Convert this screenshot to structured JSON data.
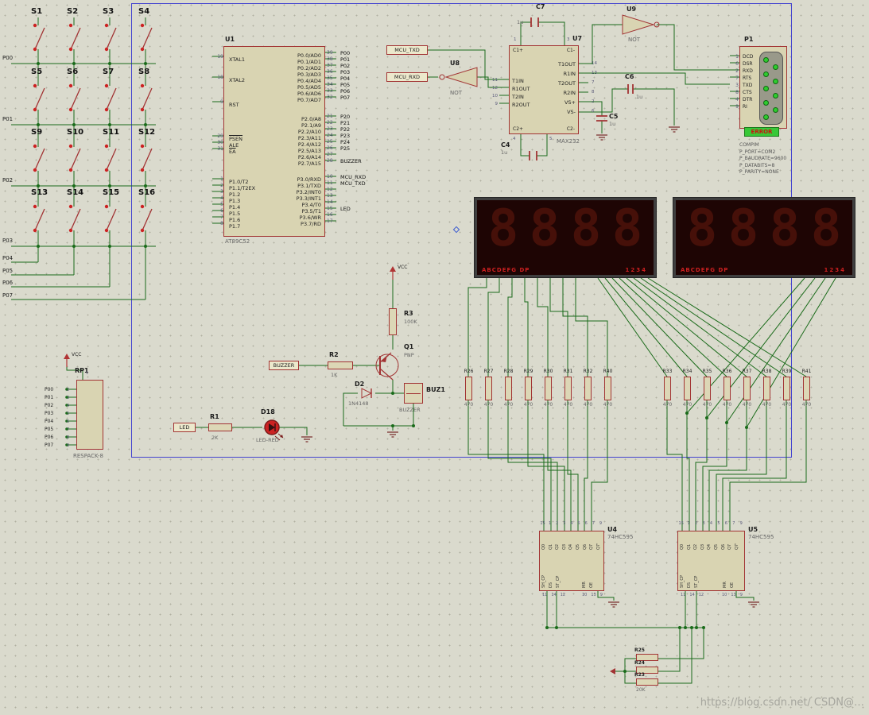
{
  "watermark": "https://blog.csdn.net/  CSDN@…",
  "power": {
    "vcc_label": "VCC"
  },
  "keypad": {
    "switches": [
      {
        "ref": "S1"
      },
      {
        "ref": "S2"
      },
      {
        "ref": "S3"
      },
      {
        "ref": "S4"
      },
      {
        "ref": "S5"
      },
      {
        "ref": "S6"
      },
      {
        "ref": "S7"
      },
      {
        "ref": "S8"
      },
      {
        "ref": "S9"
      },
      {
        "ref": "S10"
      },
      {
        "ref": "S11"
      },
      {
        "ref": "S12"
      },
      {
        "ref": "S13"
      },
      {
        "ref": "S14"
      },
      {
        "ref": "S15"
      },
      {
        "ref": "S16"
      }
    ],
    "row_nets": [
      "P00",
      "P01",
      "P02",
      "P03"
    ],
    "col_nets": [
      "P04",
      "P05",
      "P06",
      "P07"
    ]
  },
  "u1": {
    "ref": "U1",
    "part": "AT89C52",
    "left_a": [
      {
        "num": "19",
        "name": "XTAL1"
      },
      {
        "num": "18",
        "name": "XTAL2"
      },
      {
        "num": "9",
        "name": "RST"
      }
    ],
    "left_b": [
      {
        "num": "29",
        "name": "PSEN",
        "bar": true
      },
      {
        "num": "30",
        "name": "ALE"
      },
      {
        "num": "31",
        "name": "EA",
        "bar": true
      }
    ],
    "left_c": [
      {
        "num": "1",
        "name": "P1.0/T2"
      },
      {
        "num": "2",
        "name": "P1.1/T2EX"
      },
      {
        "num": "3",
        "name": "P1.2"
      },
      {
        "num": "4",
        "name": "P1.3"
      },
      {
        "num": "5",
        "name": "P1.4"
      },
      {
        "num": "6",
        "name": "P1.5"
      },
      {
        "num": "7",
        "name": "P1.6"
      },
      {
        "num": "8",
        "name": "P1.7"
      }
    ],
    "right_p0": [
      {
        "name": "P0.0/AD0",
        "num": "39",
        "net": "P00"
      },
      {
        "name": "P0.1/AD1",
        "num": "38",
        "net": "P01"
      },
      {
        "name": "P0.2/AD2",
        "num": "37",
        "net": "P02"
      },
      {
        "name": "P0.3/AD3",
        "num": "36",
        "net": "P03"
      },
      {
        "name": "P0.4/AD4",
        "num": "35",
        "net": "P04"
      },
      {
        "name": "P0.5/AD5",
        "num": "34",
        "net": "P05"
      },
      {
        "name": "P0.6/AD6",
        "num": "33",
        "net": "P06"
      },
      {
        "name": "P0.7/AD7",
        "num": "32",
        "net": "P07"
      }
    ],
    "right_p2": [
      {
        "name": "P2.0/A8",
        "num": "21",
        "net": "P20"
      },
      {
        "name": "P2.1/A9",
        "num": "22",
        "net": "P21"
      },
      {
        "name": "P2.2/A10",
        "num": "23",
        "net": "P22"
      },
      {
        "name": "P2.3/A11",
        "num": "24",
        "net": "P23"
      },
      {
        "name": "P2.4/A12",
        "num": "25",
        "net": "P24"
      },
      {
        "name": "P2.5/A13",
        "num": "26",
        "net": "P25"
      },
      {
        "name": "P2.6/A14",
        "num": "27",
        "net": ""
      },
      {
        "name": "P2.7/A15",
        "num": "28",
        "net": "BUZZER"
      }
    ],
    "right_p3": [
      {
        "name": "P3.0/RXD",
        "num": "10",
        "net": "MCU_RXD"
      },
      {
        "name": "P3.1/TXD",
        "num": "11",
        "net": "MCU_TXD"
      },
      {
        "name": "P3.2/INT0",
        "num": "12",
        "net": ""
      },
      {
        "name": "P3.3/INT1",
        "num": "13",
        "net": ""
      },
      {
        "name": "P3.4/T0",
        "num": "14",
        "net": ""
      },
      {
        "name": "P3.5/T1",
        "num": "15",
        "net": "LED"
      },
      {
        "name": "P3.6/WR",
        "num": "16",
        "net": ""
      },
      {
        "name": "P3.7/RD",
        "num": "17",
        "net": ""
      }
    ]
  },
  "serial": {
    "txd_terminal": "MCU_TXD",
    "rxd_terminal": "MCU_RXD",
    "u8": {
      "ref": "U8",
      "part": "NOT"
    },
    "u9": {
      "ref": "U9",
      "part": "NOT"
    },
    "u7": {
      "ref": "U7",
      "part": "MAX232",
      "corners": {
        "c1p": "C1+",
        "c1m": "C1-",
        "c2p": "C2+",
        "c2m": "C2-"
      },
      "left": [
        {
          "num": "11",
          "name": "T1IN"
        },
        {
          "num": "12",
          "name": "R1OUT"
        },
        {
          "num": "10",
          "name": "T2IN"
        },
        {
          "num": "9",
          "name": "R2OUT"
        }
      ],
      "right": [
        {
          "num": "14",
          "name": "T1OUT"
        },
        {
          "num": "13",
          "name": "R1IN"
        },
        {
          "num": "7",
          "name": "T2OUT"
        },
        {
          "num": "8",
          "name": "R2IN"
        },
        {
          "num": "2",
          "name": "VS+"
        },
        {
          "num": "6",
          "name": "VS-"
        }
      ],
      "top_nums": [
        "1",
        "3"
      ],
      "bottom_nums": [
        "4",
        "5"
      ]
    },
    "c7": {
      "ref": "C7",
      "val": "1u"
    },
    "c4": {
      "ref": "C4",
      "val": "1u"
    },
    "c5": {
      "ref": "C5",
      "val": "1u"
    },
    "c6": {
      "ref": "C6",
      "val": "1u"
    },
    "p1": {
      "ref": "P1",
      "pins": [
        {
          "num": "1",
          "name": "DCD"
        },
        {
          "num": "6",
          "name": "DSR"
        },
        {
          "num": "2",
          "name": "RXD"
        },
        {
          "num": "7",
          "name": "RTS"
        },
        {
          "num": "3",
          "name": "TXD"
        },
        {
          "num": "8",
          "name": "CTS"
        },
        {
          "num": "4",
          "name": "DTR"
        },
        {
          "num": "9",
          "name": "RI"
        }
      ],
      "error": "ERROR",
      "props": [
        "COMPIM",
        "P_PORT=COM2",
        "P_BAUDRATE=9600",
        "P_DATABITS=8",
        "P_PARITY=NONE"
      ]
    }
  },
  "displays": {
    "seg_label": "ABCDEFG DP",
    "digit_label": "1234",
    "digits": [
      "8",
      "8",
      "8",
      "8"
    ]
  },
  "resistors": {
    "left": [
      {
        "ref": "R26",
        "val": "470"
      },
      {
        "ref": "R27",
        "val": "470"
      },
      {
        "ref": "R28",
        "val": "470"
      },
      {
        "ref": "R29",
        "val": "470"
      },
      {
        "ref": "R30",
        "val": "470"
      },
      {
        "ref": "R31",
        "val": "470"
      },
      {
        "ref": "R32",
        "val": "470"
      },
      {
        "ref": "R40",
        "val": "470"
      }
    ],
    "right": [
      {
        "ref": "R33",
        "val": "470"
      },
      {
        "ref": "R34",
        "val": "470"
      },
      {
        "ref": "R35",
        "val": "470"
      },
      {
        "ref": "R36",
        "val": "470"
      },
      {
        "ref": "R37",
        "val": "470"
      },
      {
        "ref": "R38",
        "val": "470"
      },
      {
        "ref": "R39",
        "val": "470"
      },
      {
        "ref": "R41",
        "val": "470"
      }
    ]
  },
  "shift": {
    "u4": {
      "ref": "U4",
      "part": "74HC595"
    },
    "u5": {
      "ref": "U5",
      "part": "74HC595"
    },
    "q_labels": [
      "Q0",
      "Q1",
      "Q2",
      "Q3",
      "Q4",
      "Q5",
      "Q6",
      "Q7",
      "Q7'"
    ],
    "top_nums": [
      "15",
      "1",
      "2",
      "3",
      "4",
      "5",
      "6",
      "7",
      "9"
    ],
    "left_labels": [
      "SH_CP",
      "DS",
      "ST_CP"
    ],
    "right_labels": [
      "MR",
      "OE"
    ],
    "bottom_nums_left": [
      "11",
      "14",
      "12"
    ],
    "bottom_nums_right": [
      "10",
      "13",
      "9"
    ]
  },
  "rp1": {
    "ref": "RP1",
    "part": "RESPACK-8",
    "top_num": "1",
    "rows": [
      {
        "net": "P00",
        "num": "2"
      },
      {
        "net": "P01",
        "num": "3"
      },
      {
        "net": "P02",
        "num": "4"
      },
      {
        "net": "P03",
        "num": "5"
      },
      {
        "net": "P04",
        "num": "6"
      },
      {
        "net": "P05",
        "num": "7"
      },
      {
        "net": "P06",
        "num": "8"
      },
      {
        "net": "P07",
        "num": "9"
      }
    ]
  },
  "buzzer_circuit": {
    "r3": {
      "ref": "R3",
      "val": "100K"
    },
    "r2": {
      "ref": "R2",
      "val": "1K"
    },
    "q1": {
      "ref": "Q1",
      "val": "PNP"
    },
    "d2": {
      "ref": "D2",
      "val": "1N4148"
    },
    "buz1": {
      "ref": "BUZ1",
      "val": "BUZZER"
    },
    "terminal": "BUZZER"
  },
  "led_circuit": {
    "r1": {
      "ref": "R1",
      "val": "2K"
    },
    "d18": {
      "ref": "D18",
      "val": "LED-RED"
    },
    "terminal": "LED"
  },
  "pull_resistors": [
    {
      "ref": "R25",
      "val": ""
    },
    {
      "ref": "R24",
      "val": ""
    },
    {
      "ref": "R23",
      "val": "20K"
    }
  ]
}
